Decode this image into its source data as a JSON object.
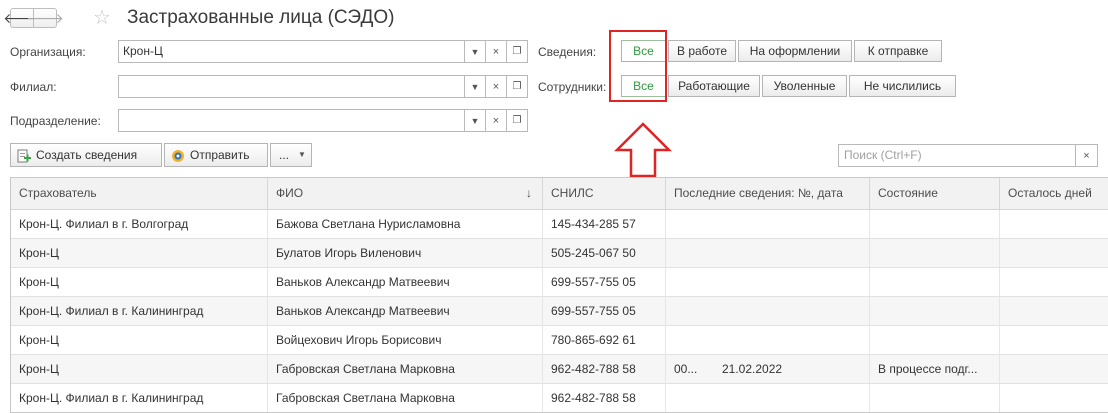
{
  "title": "Застрахованные лица (СЭДО)",
  "form": {
    "org_label": "Организация:",
    "org_value": "Крон-Ц",
    "branch_label": "Филиал:",
    "branch_value": "",
    "dept_label": "Подразделение:",
    "dept_value": ""
  },
  "filters": {
    "info_label": "Сведения:",
    "info_options": [
      "Все",
      "В работе",
      "На оформлении",
      "К отправке"
    ],
    "staff_label": "Сотрудники:",
    "staff_options": [
      "Все",
      "Работающие",
      "Уволенные",
      "Не числились"
    ]
  },
  "toolbar": {
    "create_label": "Создать сведения",
    "send_label": "Отправить",
    "more_label": "...",
    "search_placeholder": "Поиск (Ctrl+F)"
  },
  "table": {
    "columns": [
      "Страхователь",
      "ФИО",
      "СНИЛС",
      "Последние сведения: №, дата",
      "Состояние",
      "Осталось дней"
    ],
    "sort_indicator": "↓",
    "rows": [
      {
        "insurer": "Крон-Ц. Филиал в г. Волгоград",
        "name": "Бажова Светлана Нурисламовна",
        "snils": "145-434-285 57",
        "num": "",
        "date": "",
        "state": ""
      },
      {
        "insurer": "Крон-Ц",
        "name": "Булатов Игорь Виленович",
        "snils": "505-245-067 50",
        "num": "",
        "date": "",
        "state": ""
      },
      {
        "insurer": "Крон-Ц",
        "name": "Ваньков Александр Матвеевич",
        "snils": "699-557-755 05",
        "num": "",
        "date": "",
        "state": ""
      },
      {
        "insurer": "Крон-Ц. Филиал в г. Калининград",
        "name": "Ваньков Александр Матвеевич",
        "snils": "699-557-755 05",
        "num": "",
        "date": "",
        "state": ""
      },
      {
        "insurer": "Крон-Ц",
        "name": "Войцехович Игорь Борисович",
        "snils": "780-865-692 61",
        "num": "",
        "date": "",
        "state": ""
      },
      {
        "insurer": "Крон-Ц",
        "name": "Габровская Светлана Марковна",
        "snils": "962-482-788 58",
        "num": "00...",
        "date": "21.02.2022",
        "state": "В процессе подг..."
      },
      {
        "insurer": "Крон-Ц. Филиал в г. Калининград",
        "name": "Габровская Светлана Марковна",
        "snils": "962-482-788 58",
        "num": "",
        "date": "",
        "state": ""
      }
    ]
  },
  "colors": {
    "active_green": "#2e9a3c",
    "highlight_red": "#e02424"
  }
}
